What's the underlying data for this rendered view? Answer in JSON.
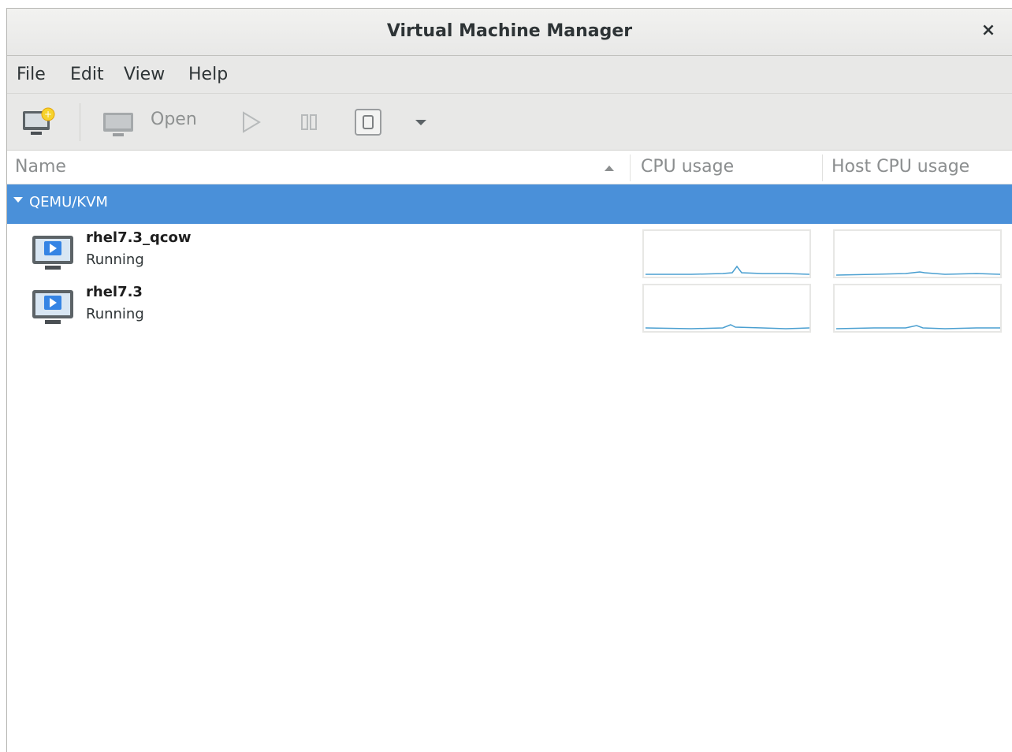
{
  "window": {
    "title": "Virtual Machine Manager",
    "close_glyph": "×"
  },
  "menu": {
    "items": [
      "File",
      "Edit",
      "View",
      "Help"
    ]
  },
  "toolbar": {
    "new_vm_icon": "new-vm-icon",
    "open_icon": "monitor-icon",
    "open_label": "Open",
    "run_icon": "play-icon",
    "pause_icon": "pause-icon",
    "shutdown_icon": "shutdown-icon",
    "shutdown_menu_icon": "chevron-down-icon"
  },
  "columns": {
    "name": "Name",
    "cpu": "CPU usage",
    "host_cpu": "Host CPU usage",
    "sort_icon": "sort-ascending-icon"
  },
  "group": {
    "label": "QEMU/KVM",
    "expanded": true
  },
  "vms": [
    {
      "name": "rhel7.3_qcow",
      "status": "Running",
      "icon": "vm-running-icon"
    },
    {
      "name": "rhel7.3",
      "status": "Running",
      "icon": "vm-running-icon"
    }
  ],
  "colors": {
    "accent": "#4a90d9",
    "graph_line": "#4a9fd0",
    "header_text": "#8b8e8f"
  }
}
